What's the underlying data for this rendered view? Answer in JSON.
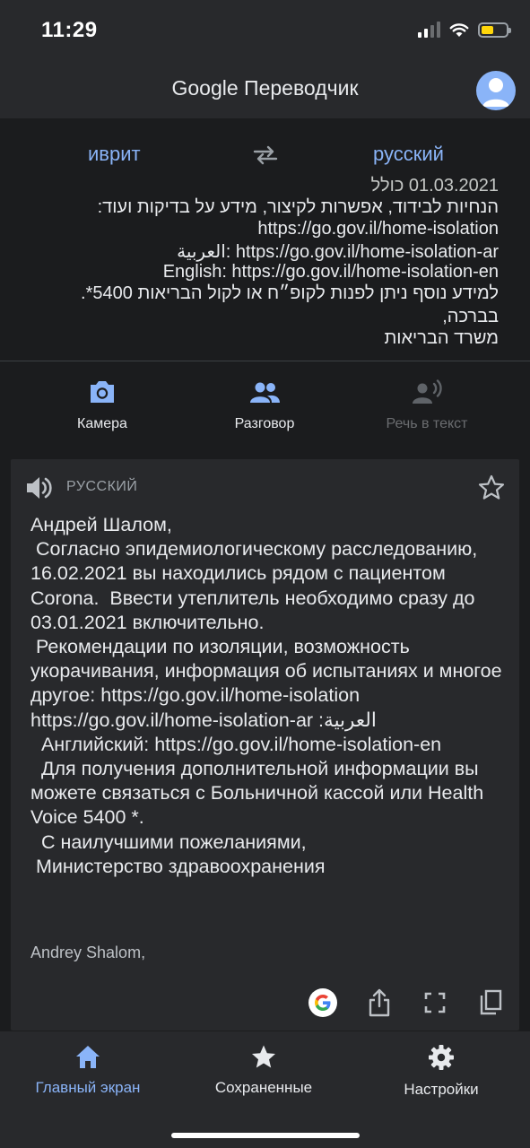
{
  "status": {
    "time": "11:29"
  },
  "header": {
    "brand": "Google",
    "app_name": "Переводчик"
  },
  "languages": {
    "source": "иврит",
    "target": "русский"
  },
  "source_lines": [
    "הנחיות לבידוד, אפשרות לקיצור, מידע על בדיקות ועוד:",
    "https://go.gov.il/home-isolation",
    "العربية: https://go.gov.il/home-isolation-ar",
    "English: https://go.gov.il/home-isolation-en",
    "למידע נוסף ניתן לפנות לקופ״ח או לקול הבריאות 5400*.",
    "בברכה,",
    "משרד הבריאות"
  ],
  "tools": {
    "camera": "Камера",
    "conversation": "Разговор",
    "speech": "Речь в текст"
  },
  "result": {
    "language": "РУССКИЙ",
    "translation": "Андрей Шалом,\n Согласно эпидемиологическому расследованию, 16.02.2021 вы находились рядом с пациентом Corona.  Ввести утеплитель необходимо сразу до 03.01.2021 включительно.\n Рекомендации по изоляции, возможность укорачивания, информация об испытаниях и многое другое: https://go.gov.il/home-isolation https://go.gov.il/home-isolation-ar :العربية\n  Английский: https://go.gov.il/home-isolation-en\n  Для получения дополнительной информации вы можете связаться с Больничной кассой или Health Voice 5400 *.\n  С наилучшими пожеланиями,\n Министерство здравоохранения",
    "transliteration": "Andrey Shalom,"
  },
  "nav": {
    "home": "Главный экран",
    "saved": "Сохраненные",
    "settings": "Настройки"
  },
  "colors": {
    "accent": "#8ab4f8",
    "background": "#1b1c1e",
    "surface": "#28292c"
  }
}
